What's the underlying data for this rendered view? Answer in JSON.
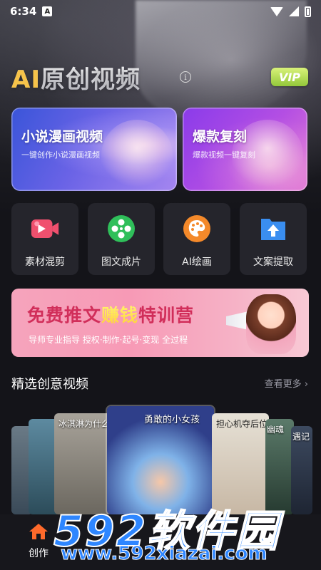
{
  "status_bar": {
    "time": "6:34",
    "notification": "A"
  },
  "header": {
    "title_ai": "AI",
    "title_rest": "原创视频",
    "info_symbol": "i",
    "vip_label": "VIP"
  },
  "feature_cards": [
    {
      "title": "小说漫画视频",
      "subtitle": "一键创作小说漫画视频"
    },
    {
      "title": "爆款复刻",
      "subtitle": "爆款视频一键复刻"
    }
  ],
  "tools": [
    {
      "label": "素材混剪",
      "icon": "video-edit-icon",
      "color": "#f0506e"
    },
    {
      "label": "图文成片",
      "icon": "film-reel-icon",
      "color": "#2fbf5a"
    },
    {
      "label": "AI绘画",
      "icon": "palette-icon",
      "color": "#f4892a"
    },
    {
      "label": "文案提取",
      "icon": "file-upload-icon",
      "color": "#3a8ef0"
    }
  ],
  "banner": {
    "title_a": "免费推文",
    "title_highlight": "赚钱",
    "title_b": "特训营",
    "subtitle": "导师专业指导 授权·制作·起号·变现 全过程"
  },
  "section": {
    "title": "精选创意视频",
    "more": "查看更多"
  },
  "videos": [
    {
      "label": "冰淇淋为什么"
    },
    {
      "label": "勇敢的小女孩"
    },
    {
      "label": "担心机夺后位"
    },
    {
      "label": "幽魂"
    },
    {
      "label": "遇记"
    }
  ],
  "bottom_nav": {
    "home_label": "创作"
  },
  "watermark": {
    "main": "592软件园",
    "url": "www.592xiazai.com"
  }
}
